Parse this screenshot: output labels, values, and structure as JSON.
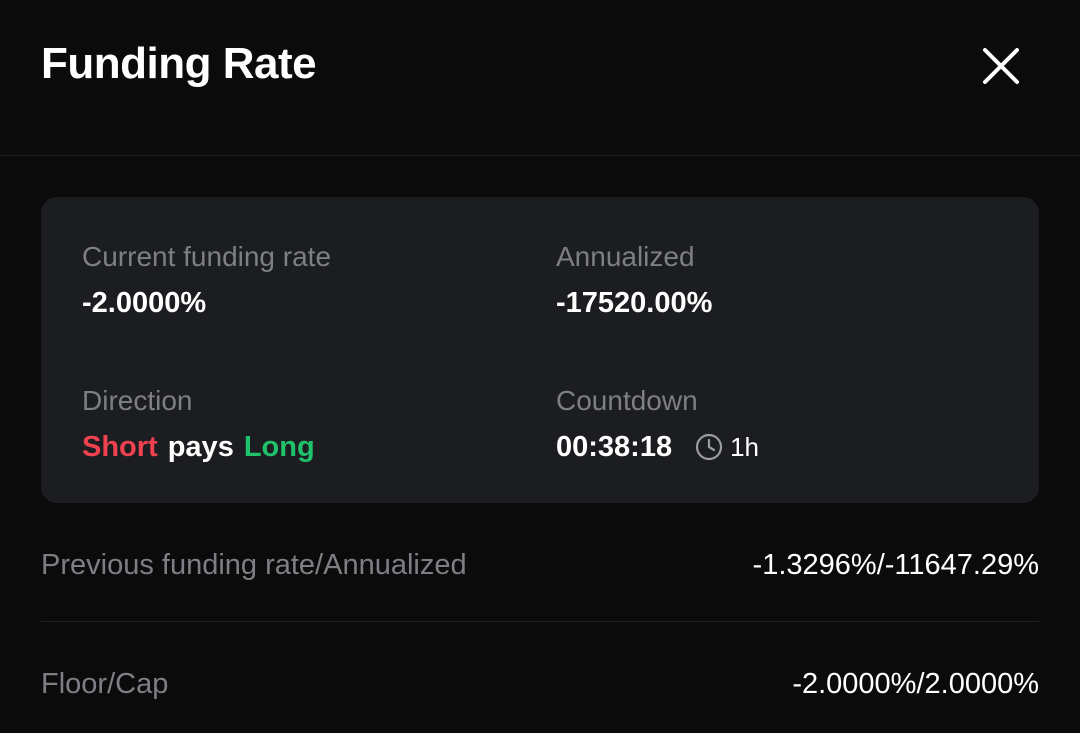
{
  "header": {
    "title": "Funding Rate",
    "close_icon": "close-icon"
  },
  "summary": {
    "current_funding_rate": {
      "label": "Current funding rate",
      "value": "-2.0000%"
    },
    "annualized": {
      "label": "Annualized",
      "value": "-17520.00%"
    },
    "direction": {
      "label": "Direction",
      "short": "Short",
      "pays": "pays",
      "long": "Long",
      "short_color": "#f0414f",
      "long_color": "#1fc16b"
    },
    "countdown": {
      "label": "Countdown",
      "value": "00:38:18",
      "interval_icon": "clock-icon",
      "interval": "1h"
    }
  },
  "details": [
    {
      "label": "Previous funding rate/Annualized",
      "value": "-1.3296%/-11647.29%"
    },
    {
      "label": "Floor/Cap",
      "value": "-2.0000%/2.0000%"
    }
  ]
}
